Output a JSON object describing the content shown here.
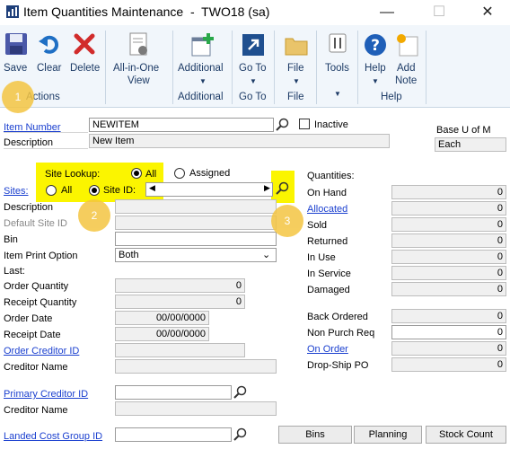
{
  "window": {
    "title": "Item Quantities Maintenance  -  TWO18 (sa)",
    "minimize": "—",
    "maximize": "☐",
    "close": "✕"
  },
  "ribbon": {
    "save": "Save",
    "clear": "Clear",
    "delete": "Delete",
    "actions_group": "Actions",
    "all_in_one": "All-in-One",
    "all_in_one_2": "View",
    "additional": "Additional",
    "additional_group": "Additional",
    "goto": "Go To",
    "goto_group": "Go To",
    "file": "File",
    "file_group": "File",
    "tools": "Tools",
    "help": "Help",
    "add_note": "Add",
    "add_note_2": "Note",
    "help_group": "Help"
  },
  "badges": [
    "1",
    "2",
    "3"
  ],
  "form": {
    "item_number_label": "Item Number",
    "item_number_value": "NEWITEM",
    "inactive_label": "Inactive",
    "base_uom_label": "Base U of M",
    "base_uom_value": "Each",
    "description_label": "Description",
    "description_value": "New Item",
    "site_lookup_label": "Site Lookup:",
    "site_lookup_all": "All",
    "site_lookup_assigned": "Assigned",
    "sites_label": "Sites:",
    "sites_all": "All",
    "sites_site_id": "Site ID:",
    "site_description_label": "Description",
    "default_site_label": "Default Site ID",
    "bin_label": "Bin",
    "item_print_label": "Item Print Option",
    "item_print_value": "Both",
    "last_label": "Last:",
    "order_qty_label": "Order Quantity",
    "order_qty_value": "0",
    "receipt_qty_label": "Receipt Quantity",
    "receipt_qty_value": "0",
    "order_date_label": "Order Date",
    "order_date_value": "00/00/0000",
    "receipt_date_label": "Receipt Date",
    "receipt_date_value": "00/00/0000",
    "order_creditor_label": "Order Creditor ID",
    "creditor_name_label": "Creditor Name",
    "primary_creditor_label": "Primary Creditor ID",
    "creditor_name2_label": "Creditor Name",
    "landed_cost_label": "Landed Cost Group ID"
  },
  "quantities": {
    "header": "Quantities:",
    "rows": [
      {
        "label": "On Hand",
        "value": "0"
      },
      {
        "label": "Allocated",
        "value": "0"
      },
      {
        "label": "Sold",
        "value": "0"
      },
      {
        "label": "Returned",
        "value": "0"
      },
      {
        "label": "In Use",
        "value": "0"
      },
      {
        "label": "In Service",
        "value": "0"
      },
      {
        "label": "Damaged",
        "value": "0"
      }
    ],
    "rows2": [
      {
        "label": "Back Ordered",
        "value": "0"
      },
      {
        "label": "Non Purch Req",
        "value": "0"
      },
      {
        "label": "On Order",
        "value": "0"
      },
      {
        "label": "Drop-Ship PO",
        "value": "0"
      }
    ]
  },
  "buttons": {
    "bins": "Bins",
    "planning": "Planning",
    "stock_count": "Stock Count"
  }
}
